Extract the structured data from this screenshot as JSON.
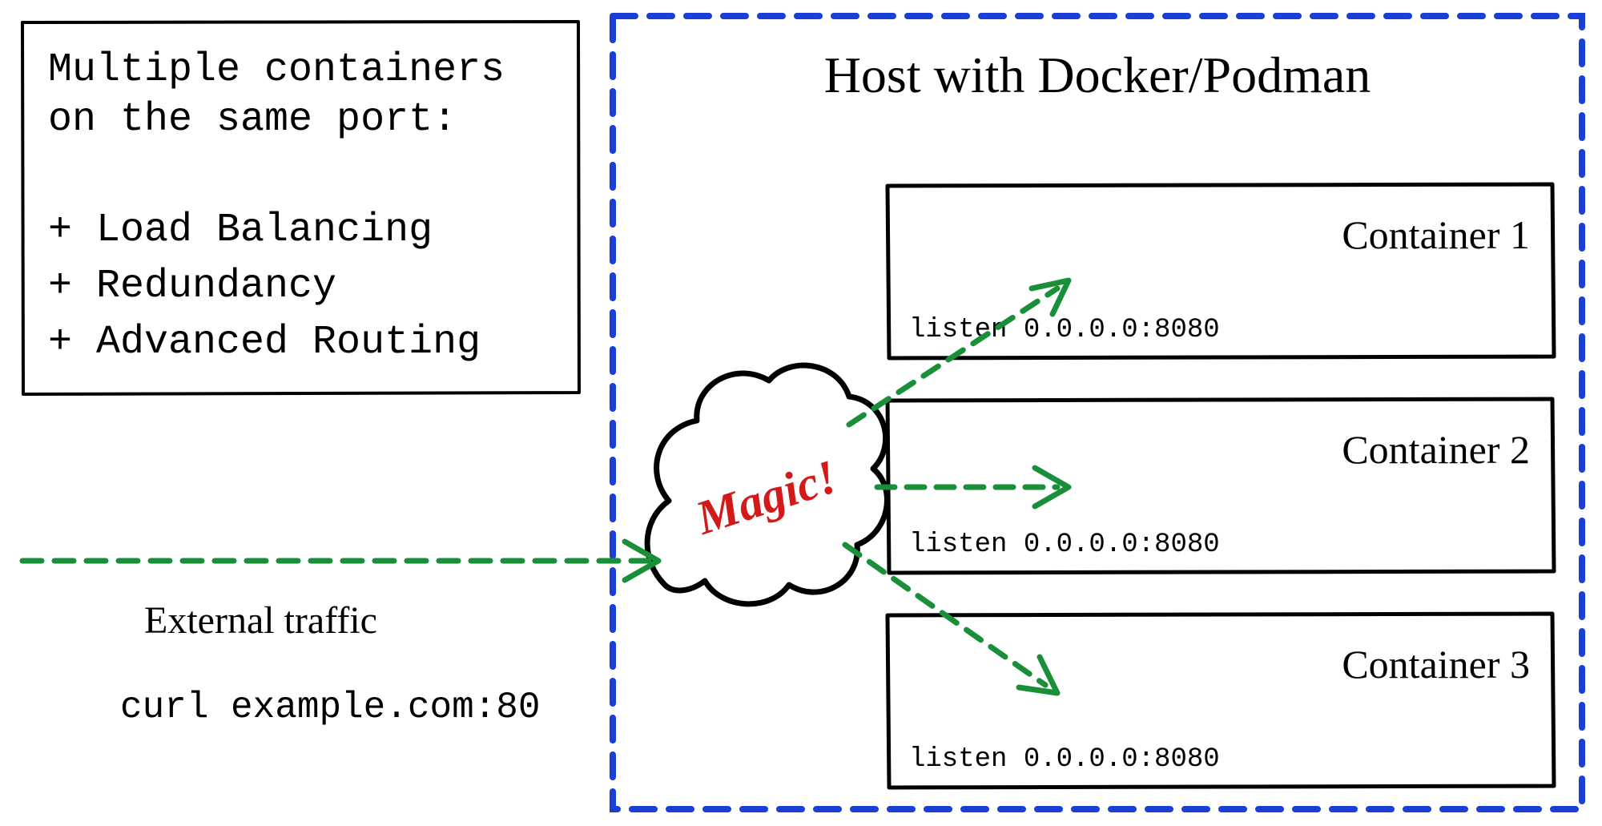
{
  "infoBox": {
    "title1": "Multiple containers",
    "title2": "on the same port:",
    "items": [
      "+ Load Balancing",
      "+ Redundancy",
      "+ Advanced Routing"
    ]
  },
  "external": {
    "label": "External traffic",
    "command": "curl example.com:80"
  },
  "host": {
    "title": "Host with Docker/Podman",
    "magic": "Magic!",
    "containers": [
      {
        "title": "Container 1",
        "listen": "listen 0.0.0.0:8080"
      },
      {
        "title": "Container 2",
        "listen": "listen 0.0.0.0:8080"
      },
      {
        "title": "Container 3",
        "listen": "listen 0.0.0.0:8080"
      }
    ]
  },
  "colors": {
    "blue": "#1a3fd6",
    "green": "#1a8f3a",
    "red": "#d31a1a",
    "black": "#000000"
  }
}
